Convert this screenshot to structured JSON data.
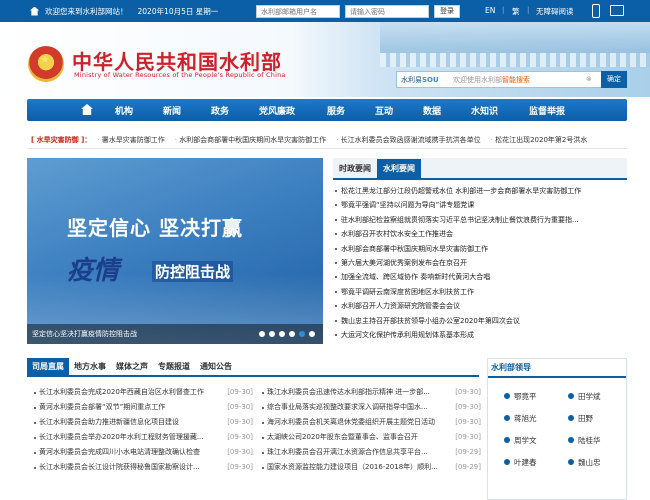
{
  "topbar": {
    "welcome": "欢迎您来到水利部网站！",
    "date": "2020年10月5日 星期一",
    "username_placeholder": "水利部邮箱用户名",
    "password_placeholder": "请输入密码",
    "login_label": "登录",
    "lang_en": "EN",
    "sep": "|",
    "lang_traditional": "繁",
    "accessibility": "无障碍阅读"
  },
  "header": {
    "site_name": "中华人民共和国水利部",
    "site_name_en": "Ministry of Water Resources of the People's Republic of China",
    "search_brand": "水利易",
    "search_brand_highlight": "SOU",
    "search_placeholder_prefix": "欢迎使用水利部",
    "search_placeholder_highlight": "智能搜索",
    "search_clear": "⊗",
    "search_button": "确定"
  },
  "nav": {
    "items": [
      "机构",
      "新闻",
      "政务",
      "党风廉政",
      "服务",
      "互动",
      "数据",
      "水知识",
      "监督举报"
    ]
  },
  "ticker": {
    "label": "[ 水旱灾害防御 ]：",
    "items": [
      "署水旱灾害防御工作",
      "水利部会商部署中秋国庆期间水旱灾害防御工作",
      "长江水利委员会致函感谢流域携手抗洪各单位",
      "松花江出现2020年第2号洪水"
    ]
  },
  "slider": {
    "headline": "坚定信心 坚决打赢",
    "headline_italic": "疫情",
    "headline_sub": "防控阻击战",
    "caption": "坚定信心坚决打赢疫情防控阻击战",
    "dot_count": 6,
    "active_dot": 4
  },
  "news": {
    "tabs": [
      "时政要闻",
      "水利要闻"
    ],
    "active_tab": 1,
    "items": [
      "松花江黑龙江部分江段仍超警戒水位 水利部进一步会商部署水旱灾害防御工作",
      "鄂竟平强调“坚持以问题为导向”讲专题党课",
      "驻水利部纪检监察组就贯彻落实习近平总书记坚决制止餐饮浪费行为重要指...",
      "水利部召开农村饮水安全工作推进会",
      "水利部会商部署中秋国庆期间水旱灾害防御工作",
      "第六届大美河湖优秀案例发布会在京召开",
      "加强全流域、跨区域协作 奏响新时代黄河大合唱",
      "鄂竟平调研云南深度贫困地区水利扶贫工作",
      "水利部召开人力资源研究院管委会会议",
      "魏山忠主持召开部扶贫领导小组办公室2020年第四次会议",
      "大运河文化保护传承利用规划体系基本形成"
    ]
  },
  "bureau": {
    "tabs": [
      "司局直属",
      "地方水事",
      "媒体之声",
      "专题报道",
      "通知公告"
    ],
    "active_tab": 0,
    "left": [
      {
        "title": "长江水利委员会完成2020年西藏自治区水利督查工作",
        "date": "[09-30]"
      },
      {
        "title": "黄河水利委员会部署“双节”期间重点工作",
        "date": "[09-30]"
      },
      {
        "title": "长江水利委员会助力推进新疆信息化项目建设",
        "date": "[09-30]"
      },
      {
        "title": "长江水利委员会举办2020年水利工程财务管理援藏...",
        "date": "[09-30]"
      },
      {
        "title": "黄河水利委员会完成四川小水电站清理整改确认检查",
        "date": "[09-30]"
      },
      {
        "title": "长江水利委员会长江设计院获得秘鲁国家勘察设计...",
        "date": "[09-30]"
      }
    ],
    "right": [
      {
        "title": "珠江水利委员会迅速传达水利部指示精神 进一步部...",
        "date": "[09-30]"
      },
      {
        "title": "综合事业局落实巡视整改要求深入调研指导中国水...",
        "date": "[09-30]"
      },
      {
        "title": "海河水利委员会机关离退休党委组织开展主题党日活动",
        "date": "[09-30]"
      },
      {
        "title": "太湖峡公司2020年股东会暨董事会、监事会召开",
        "date": "[09-30]"
      },
      {
        "title": "珠江水利委员会召开漓江水资源合作信息共享平台...",
        "date": "[09-29]"
      },
      {
        "title": "国家水资源监控能力建设项目（2016-2018年）顺利...",
        "date": "[09-29]"
      }
    ]
  },
  "leaders": {
    "title": "水利部领导",
    "names": [
      "鄂竟平",
      "田学斌",
      "蒋旭光",
      "田野",
      "周学文",
      "陆桂华",
      "叶建春",
      "魏山忠"
    ]
  },
  "colors": {
    "primary_blue": "#0b5fa6",
    "title_red": "#d0202a",
    "accent_orange": "#e85a00"
  }
}
